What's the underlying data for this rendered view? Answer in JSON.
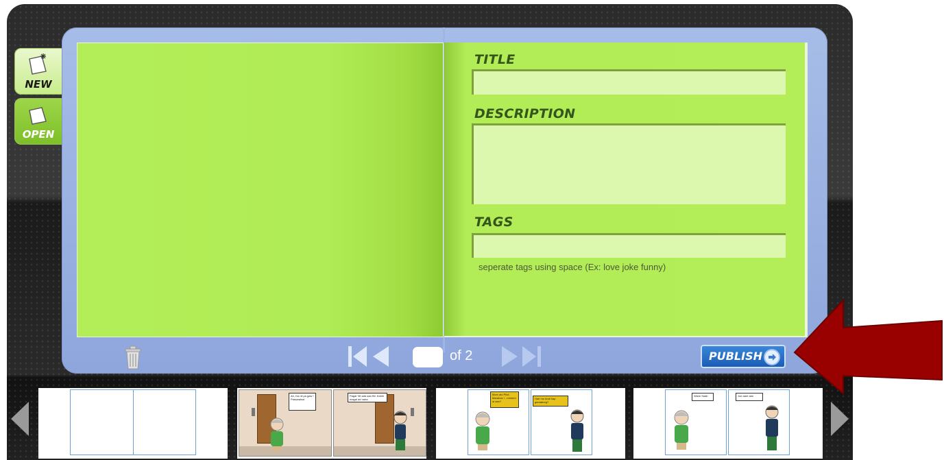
{
  "sidebar": {
    "new_label": "NEW",
    "open_label": "OPEN"
  },
  "book": {
    "title_label": "TITLE",
    "title_value": "",
    "description_label": "DESCRIPTION",
    "description_value": "",
    "tags_label": "TAGS",
    "tags_value": "",
    "tags_hint": "seperate tags using space (Ex: love joke funny)"
  },
  "pager": {
    "current_page": "",
    "of_label": "of 2"
  },
  "publish": {
    "label": "PUBLISH"
  },
  "thumbnails": {
    "t2_left_bubble": "Ah, Da nil pa gaw ! Passwalna!",
    "t2_right_bubble": "Pagal 'Mi ada aan Bil. Kabhi magal ad naha.",
    "t3_left_bubble": "Mom ato Pilot. Marahan ! ..mmmm ia aan?",
    "t3_right_bubble": "Hair mo Andi kap gamaburg?",
    "t4_left_bubble": "Wave Saab",
    "t4_right_bubble": "Joe aant aan"
  },
  "colors": {
    "page_green": "#b3ee58",
    "frame_blue": "#9db4e4",
    "publish_blue": "#1c5db5",
    "annotation_arrow": "#990000"
  }
}
